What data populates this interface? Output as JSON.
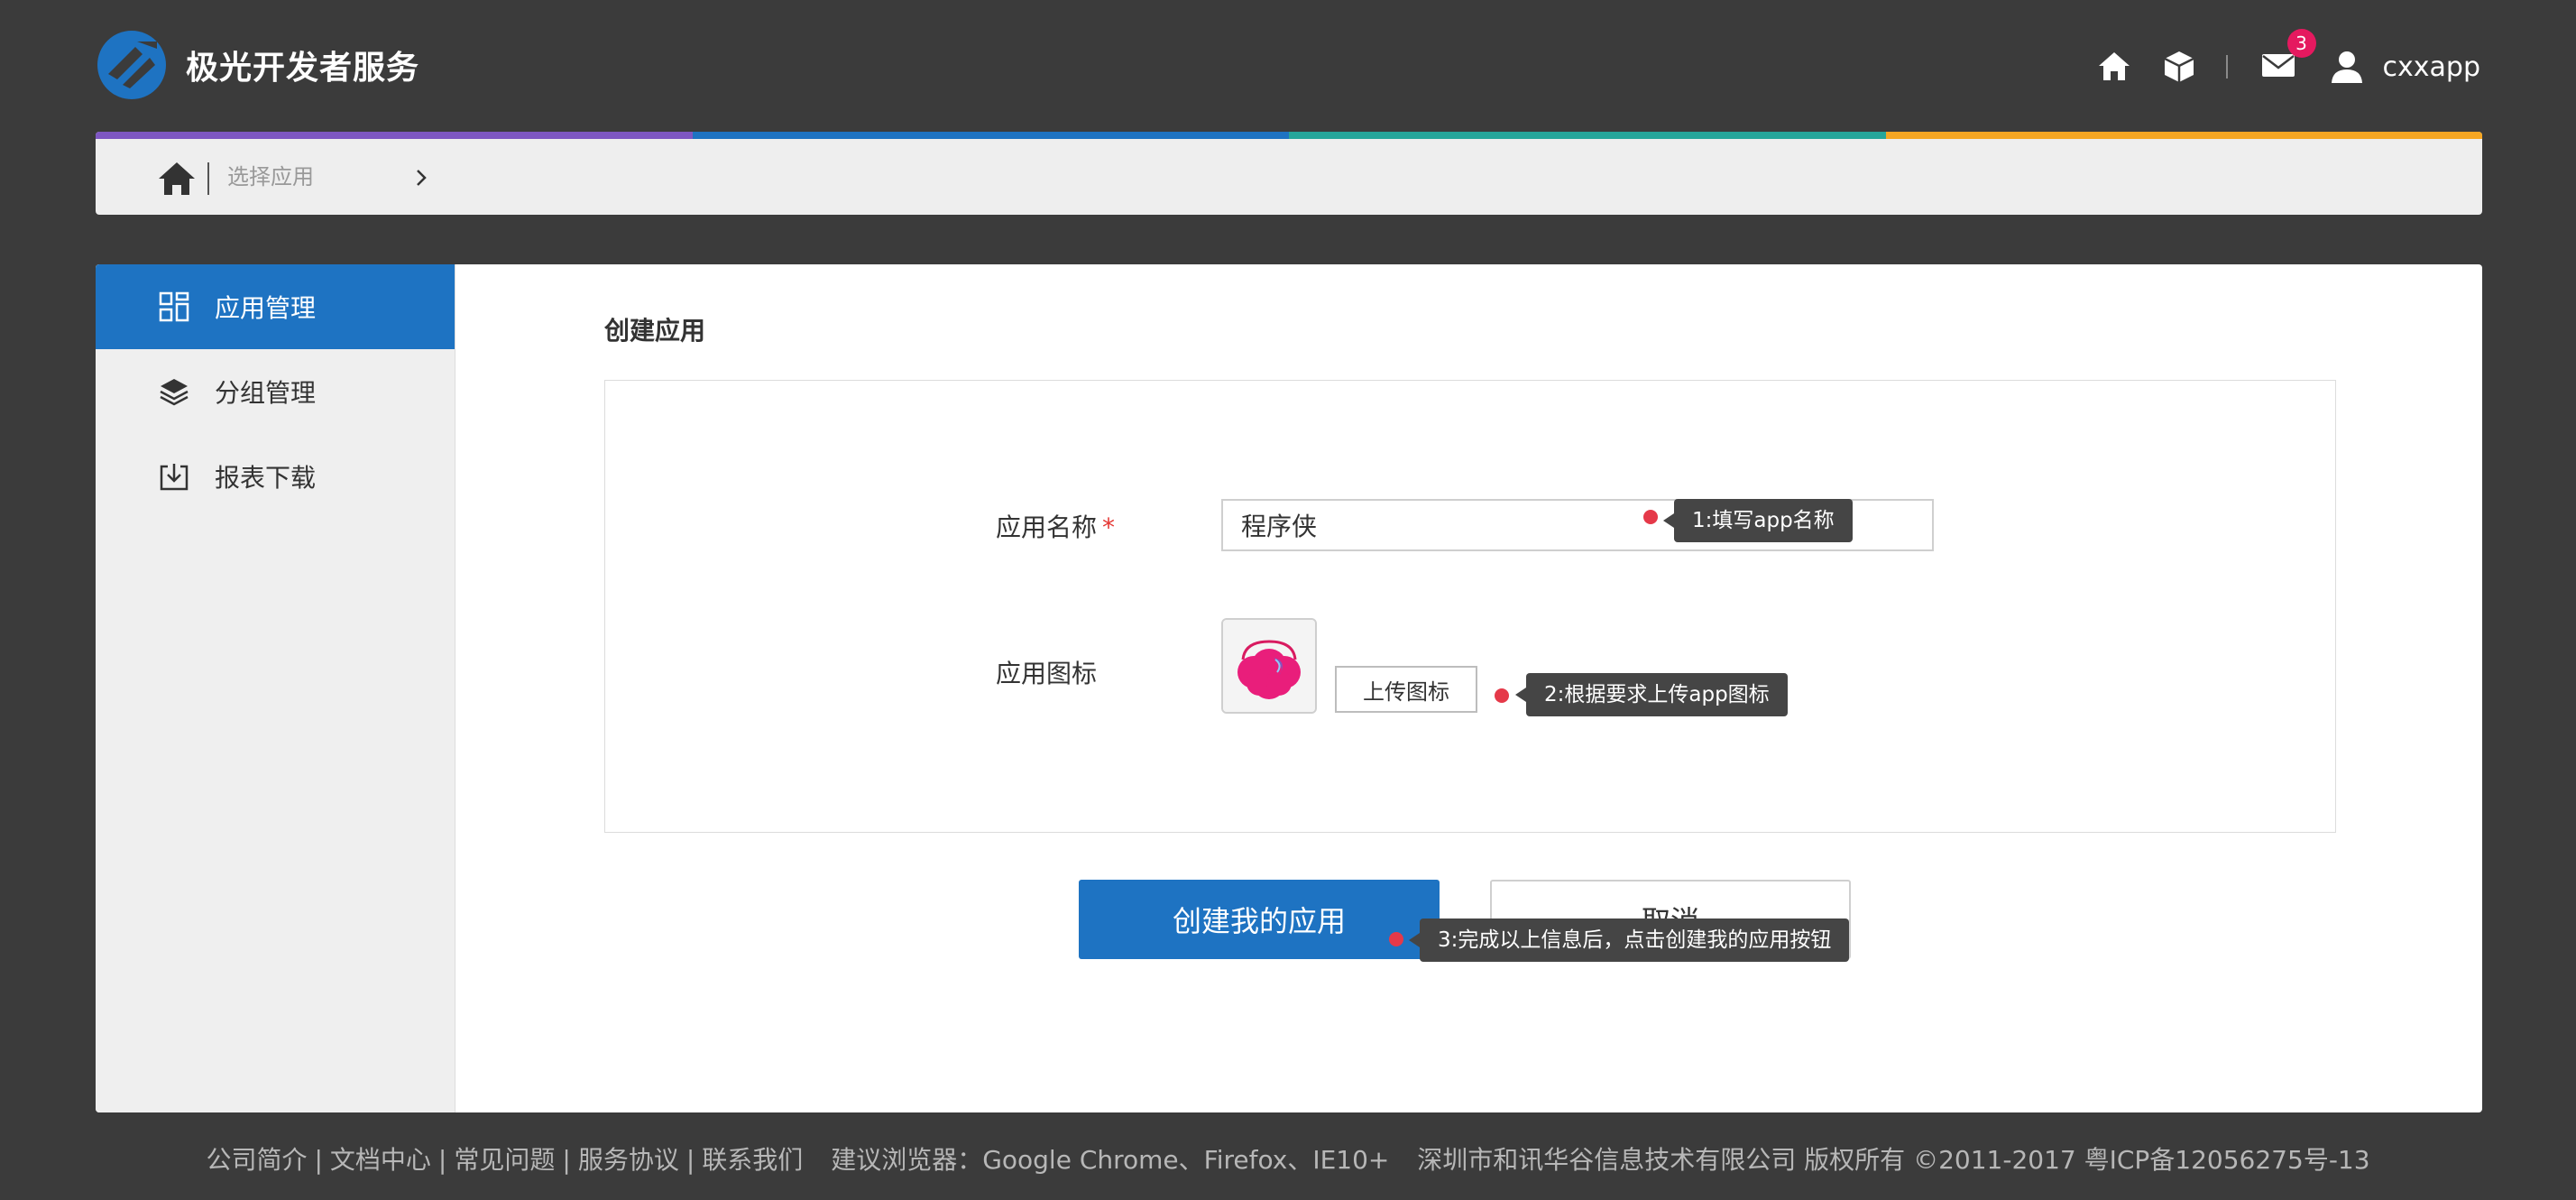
{
  "header": {
    "brand_title": "极光开发者服务",
    "icons": [
      "home-icon",
      "box-icon",
      "mail-icon",
      "user-icon"
    ],
    "mail_badge": "3",
    "username": "cxxapp"
  },
  "colors": {
    "accent": "#1e73c2",
    "strip": [
      "#7e57c2",
      "#1e73c2",
      "#26a69a",
      "#f5a623"
    ],
    "badge": "#e5195f",
    "required": "#e53935"
  },
  "breadcrumb": {
    "select_app": "选择应用"
  },
  "sidebar": {
    "items": [
      {
        "label": "应用管理",
        "icon": "grid-icon",
        "active": true
      },
      {
        "label": "分组管理",
        "icon": "layers-icon",
        "active": false
      },
      {
        "label": "报表下载",
        "icon": "download-icon",
        "active": false
      }
    ]
  },
  "form": {
    "title": "创建应用",
    "name_label": "应用名称",
    "required_mark": "*",
    "name_value": "程序侠",
    "icon_label": "应用图标",
    "upload_label": "上传图标",
    "submit_label": "创建我的应用",
    "cancel_label": "取消"
  },
  "tips": {
    "tip1": "1:填写app名称",
    "tip2": "2:根据要求上传app图标",
    "tip3": "3:完成以上信息后，点击创建我的应用按钮"
  },
  "footer": {
    "links": [
      "公司简介",
      "文档中心",
      "常见问题",
      "服务协议",
      "联系我们"
    ],
    "browser": "建议浏览器：Google Chrome、Firefox、IE10+",
    "copyright": "深圳市和讯华谷信息技术有限公司 版权所有 ©2011-2017 粤ICP备12056275号-13"
  }
}
